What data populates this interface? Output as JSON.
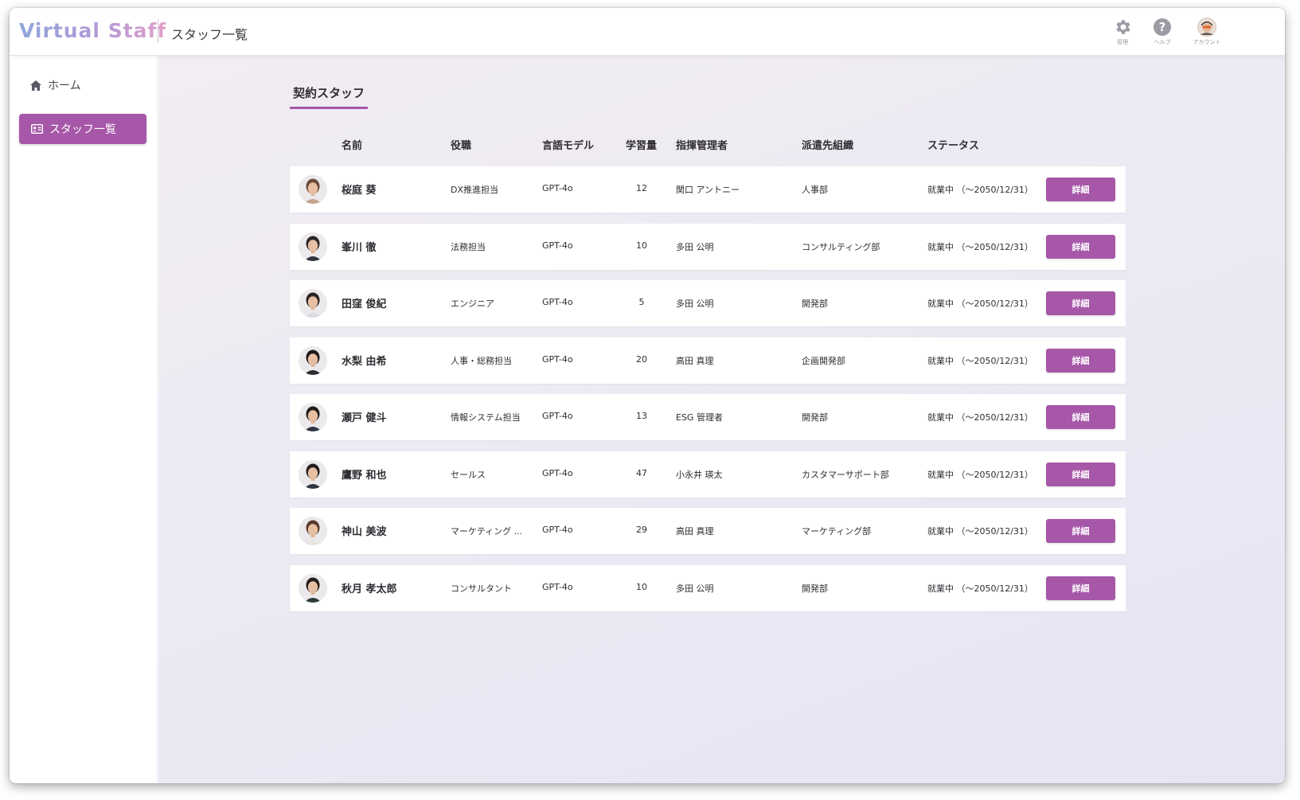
{
  "app": {
    "logo": "Virtual Staff",
    "page_title": "スタッフ一覧"
  },
  "header_icons": [
    {
      "icon": "gear-icon",
      "caption": "管理"
    },
    {
      "icon": "help-icon",
      "caption": "ヘルプ"
    },
    {
      "icon": "account-avatar",
      "caption": "アカウント"
    }
  ],
  "sidebar": {
    "items": [
      {
        "label": "ホーム",
        "icon": "home-icon",
        "active": false
      },
      {
        "label": "スタッフ一覧",
        "icon": "id-card-icon",
        "active": true
      }
    ]
  },
  "section": {
    "title": "契約スタッフ"
  },
  "table": {
    "headers": {
      "name": "名前",
      "role": "役職",
      "model": "言語モデル",
      "amount": "学習量",
      "manager": "指揮管理者",
      "org": "派遣先組織",
      "status": "ステータス"
    },
    "button_label": "詳細",
    "rows": [
      {
        "name": "桜庭 葵",
        "role": "DX推進担当",
        "model": "GPT-4o",
        "amount": "12",
        "manager": "関口 アントニー",
        "org": "人事部",
        "status": "就業中 （〜2050/12/31）",
        "avatar_hair": "#6b4a3a",
        "avatar_top": "#c9a38e"
      },
      {
        "name": "峯川 徹",
        "role": "法務担当",
        "model": "GPT-4o",
        "amount": "10",
        "manager": "多田 公明",
        "org": "コンサルティング部",
        "status": "就業中 （〜2050/12/31）",
        "avatar_hair": "#2b2624",
        "avatar_top": "#2f3440"
      },
      {
        "name": "田窪 俊紀",
        "role": "エンジニア",
        "model": "GPT-4o",
        "amount": "5",
        "manager": "多田 公明",
        "org": "開発部",
        "status": "就業中 （〜2050/12/31）",
        "avatar_hair": "#2a2522",
        "avatar_top": "#d8dce2"
      },
      {
        "name": "水梨 由希",
        "role": "人事・総務担当",
        "model": "GPT-4o",
        "amount": "20",
        "manager": "高田 真理",
        "org": "企画開発部",
        "status": "就業中 （〜2050/12/31）",
        "avatar_hair": "#1f1a18",
        "avatar_top": "#2c2c30"
      },
      {
        "name": "瀬戸 健斗",
        "role": "情報システム担当",
        "model": "GPT-4o",
        "amount": "13",
        "manager": "ESG 管理者",
        "org": "開発部",
        "status": "就業中 （〜2050/12/31）",
        "avatar_hair": "#201c1a",
        "avatar_top": "#2e3442"
      },
      {
        "name": "鷹野 和也",
        "role": "セールス",
        "model": "GPT-4o",
        "amount": "47",
        "manager": "小永井 瑛太",
        "org": "カスタマーサポート部",
        "status": "就業中 （〜2050/12/31）",
        "avatar_hair": "#231e1c",
        "avatar_top": "#30343c"
      },
      {
        "name": "神山 美波",
        "role": "マーケティング ...",
        "model": "GPT-4o",
        "amount": "29",
        "manager": "高田 真理",
        "org": "マーケティング部",
        "status": "就業中 （〜2050/12/31）",
        "avatar_hair": "#5a3b2c",
        "avatar_top": "#e9e4de"
      },
      {
        "name": "秋月 孝太郎",
        "role": "コンサルタント",
        "model": "GPT-4o",
        "amount": "10",
        "manager": "多田 公明",
        "org": "開発部",
        "status": "就業中 （〜2050/12/31）",
        "avatar_hair": "#221d1b",
        "avatar_top": "#2d3a3a"
      }
    ]
  },
  "colors": {
    "accent": "#a657a8",
    "background": "#ece9f3"
  }
}
